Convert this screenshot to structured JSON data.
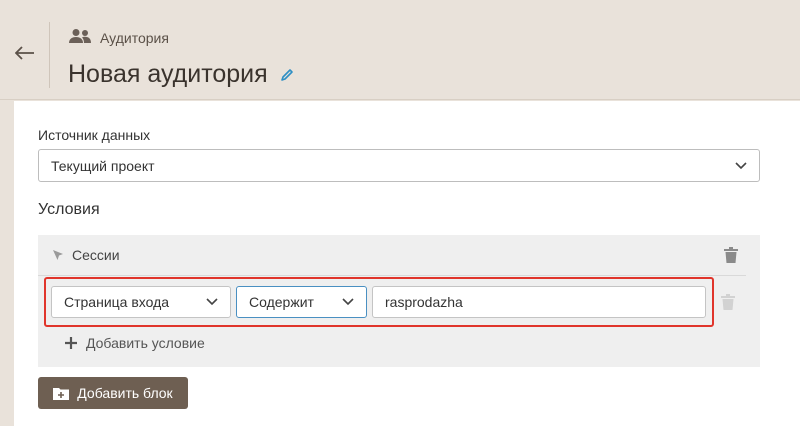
{
  "header": {
    "breadcrumb_label": "Аудитория",
    "title": "Новая аудитория"
  },
  "form": {
    "source_label": "Источник данных",
    "source_value": "Текущий проект",
    "conditions_title": "Условия"
  },
  "block": {
    "title": "Сессии",
    "condition": {
      "field_value": "Страница входа",
      "operator_value": "Содержит",
      "input_value": "rasprodazha"
    },
    "add_condition_label": "Добавить условие"
  },
  "add_block_label": "Добавить блок",
  "colors": {
    "background": "#e9e2da",
    "primary_button": "#6e5f52",
    "highlight_border": "#e0352b",
    "edit_icon": "#2e8fc4"
  },
  "icons": {
    "back": "arrow-left-icon",
    "audience": "users-icon",
    "edit": "pencil-icon",
    "session": "cursor-icon",
    "delete": "trash-icon",
    "chevron": "chevron-down-icon",
    "add": "plus-icon",
    "add_block": "folder-plus-icon"
  }
}
